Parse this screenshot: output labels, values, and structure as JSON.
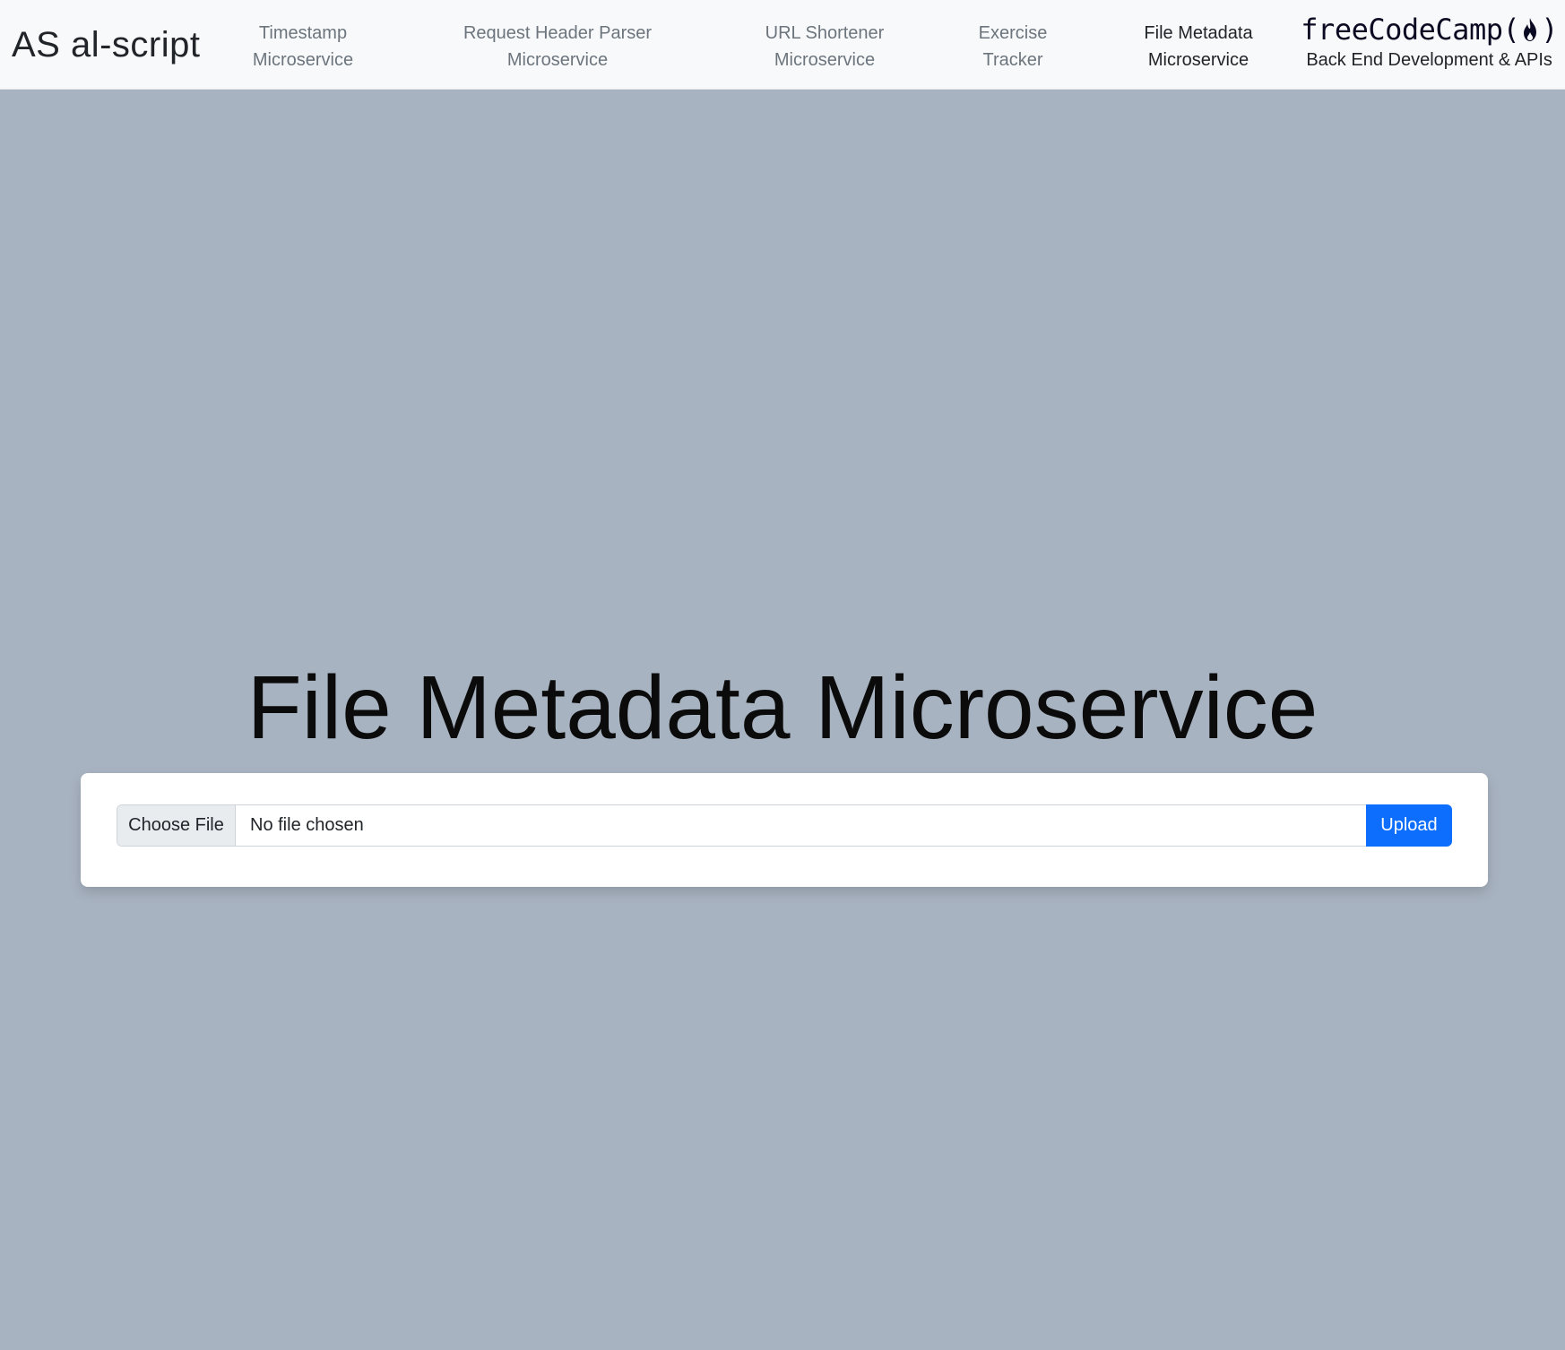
{
  "nav": {
    "brand": "AS al-script",
    "links": [
      {
        "line1": "Timestamp",
        "line2": "Microservice",
        "active": false
      },
      {
        "line1": "Request Header Parser",
        "line2": "Microservice",
        "active": false
      },
      {
        "line1": "URL Shortener",
        "line2": "Microservice",
        "active": false
      },
      {
        "line1": "Exercise",
        "line2": "Tracker",
        "active": false
      },
      {
        "line1": "File Metadata",
        "line2": "Microservice",
        "active": true
      }
    ],
    "fcc": {
      "logo_left": "freeCodeCamp(",
      "logo_icon": "flame-icon",
      "logo_right": ")",
      "subtitle": "Back End Development & APIs"
    }
  },
  "main": {
    "title": "File Metadata Microservice",
    "form": {
      "choose_label": "Choose File",
      "file_status": "No file chosen",
      "upload_label": "Upload"
    }
  },
  "colors": {
    "background": "#a8b3c1",
    "navbar": "#f8f9fa",
    "primary": "#0d6efd",
    "nav_inactive": "#6c757d",
    "nav_active": "#212529"
  }
}
